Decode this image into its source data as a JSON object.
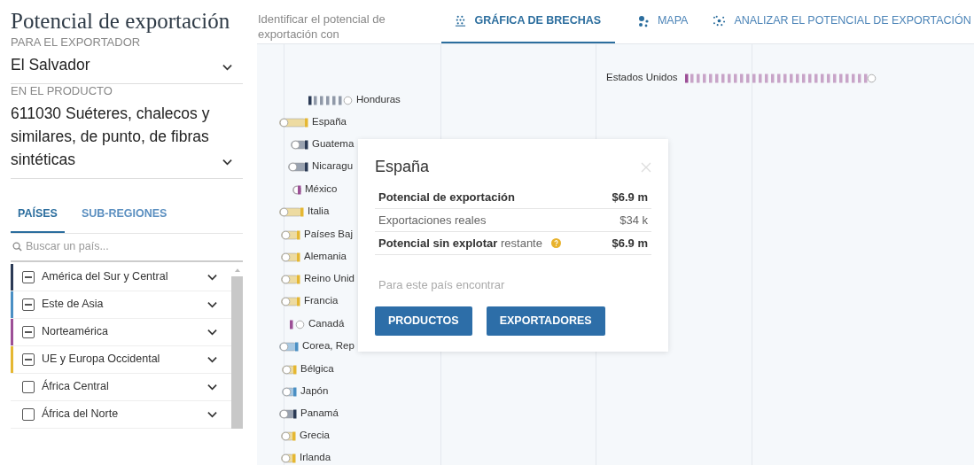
{
  "title": "Potencial de exportación",
  "exporter": {
    "label": "PARA EL EXPORTADOR",
    "value": "El Salvador"
  },
  "product": {
    "label": "EN EL PRODUCTO",
    "value": "611030 Suéteres, chalecos y similares, de punto, de fibras sintéticas"
  },
  "list_tabs": [
    {
      "label": "PAÍSES",
      "selected": true
    },
    {
      "label": "SUB-REGIONES",
      "selected": false
    }
  ],
  "search": {
    "placeholder": "Buscar un país..."
  },
  "regions": [
    {
      "label": "América del Sur y Central",
      "indeterminate": true,
      "color": "#2b3a55"
    },
    {
      "label": "Este de Asia",
      "indeterminate": true,
      "color": "#4a8fc4"
    },
    {
      "label": "Norteamérica",
      "indeterminate": true,
      "color": "#9c4f96"
    },
    {
      "label": "UE y Europa Occidental",
      "indeterminate": true,
      "color": "#e5b732"
    },
    {
      "label": "África Central",
      "indeterminate": false
    },
    {
      "label": "África del Norte",
      "indeterminate": false
    }
  ],
  "intro": "Identificar el potencial de exportación con",
  "tabs": [
    {
      "label": "GRÁFICA DE BRECHAS",
      "selected": true
    },
    {
      "label": "MAPA",
      "selected": false
    },
    {
      "label": "ANALIZAR EL POTENCIAL DE EXPORTACIÓN",
      "selected": false
    }
  ],
  "chart": {
    "items": [
      {
        "label": "Estados Unidos",
        "color": "#9c4f96"
      },
      {
        "label": "Honduras",
        "color": "#2b3a55"
      },
      {
        "label": "España",
        "color": "#e5b732"
      },
      {
        "label": "Guatema",
        "color": "#2b3a55"
      },
      {
        "label": "Nicaragu",
        "color": "#2b3a55"
      },
      {
        "label": "México",
        "color": "#9c4f96"
      },
      {
        "label": "Italia",
        "color": "#e5b732"
      },
      {
        "label": "Países Baj",
        "color": "#e5b732"
      },
      {
        "label": "Alemania",
        "color": "#e5b732"
      },
      {
        "label": "Reino Unid",
        "color": "#e5b732"
      },
      {
        "label": "Francia",
        "color": "#e5b732"
      },
      {
        "label": "Canadá",
        "color": "#9c4f96"
      },
      {
        "label": "Corea, Rep",
        "color": "#4a8fc4"
      },
      {
        "label": "Bélgica",
        "color": "#e5b732"
      },
      {
        "label": "Japón",
        "color": "#4a8fc4"
      },
      {
        "label": "Panamá",
        "color": "#2b3a55"
      },
      {
        "label": "Grecia",
        "color": "#e5b732"
      },
      {
        "label": "Irlanda",
        "color": "#e5b732"
      }
    ]
  },
  "popup": {
    "title": "España",
    "rows": [
      {
        "kind": "total",
        "label": "Potencial de exportación",
        "value": "$6.9 m",
        "help": false
      },
      {
        "kind": "plain",
        "label": "Exportaciones reales",
        "value": "$34 k",
        "help": false
      },
      {
        "kind": "split",
        "label": "**Potencial sin explotar** restante",
        "value": "$6.9 m",
        "help": true
      }
    ],
    "prompt": "Para este país encontrar",
    "buttons": [
      "PRODUCTOS",
      "EXPORTADORES"
    ]
  }
}
